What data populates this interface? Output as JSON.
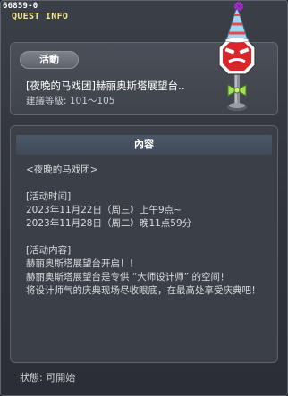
{
  "window": {
    "quest_id": "66859-0",
    "header_label": "QUEST INFO"
  },
  "quest": {
    "category": "活動",
    "title": "[夜晚的马戏团]赫丽奥斯塔展望台‥",
    "level_label": "建議等級: 101～105"
  },
  "content": {
    "header": "內容",
    "lines": [
      "<夜晚的马戏团>",
      "",
      "[活动时间]",
      "2023年11月22日（周三）上午9点~",
      "2023年11月28日（周二）晚11点59分",
      "",
      "[活动内容]",
      "赫丽奥斯塔展望台开启！！",
      "赫丽奥斯塔展望台是专供 “大师设计师” 的空间！",
      "将设计师气的庆典现场尽收眼底，在最高处享受庆典吧！"
    ]
  },
  "status": {
    "text": "狀態: 可開始"
  },
  "npc": {
    "icon": "party-hat-stop-sign-icon"
  },
  "colors": {
    "title_yellow": "#f3e88c",
    "panel": "#3b3f47",
    "header_bar": "#4c5767",
    "sign_red": "#d8262b",
    "bow_green": "#a6e05a",
    "hat_blue": "#9ed8f0",
    "pompom_purple": "#a43cc9"
  }
}
